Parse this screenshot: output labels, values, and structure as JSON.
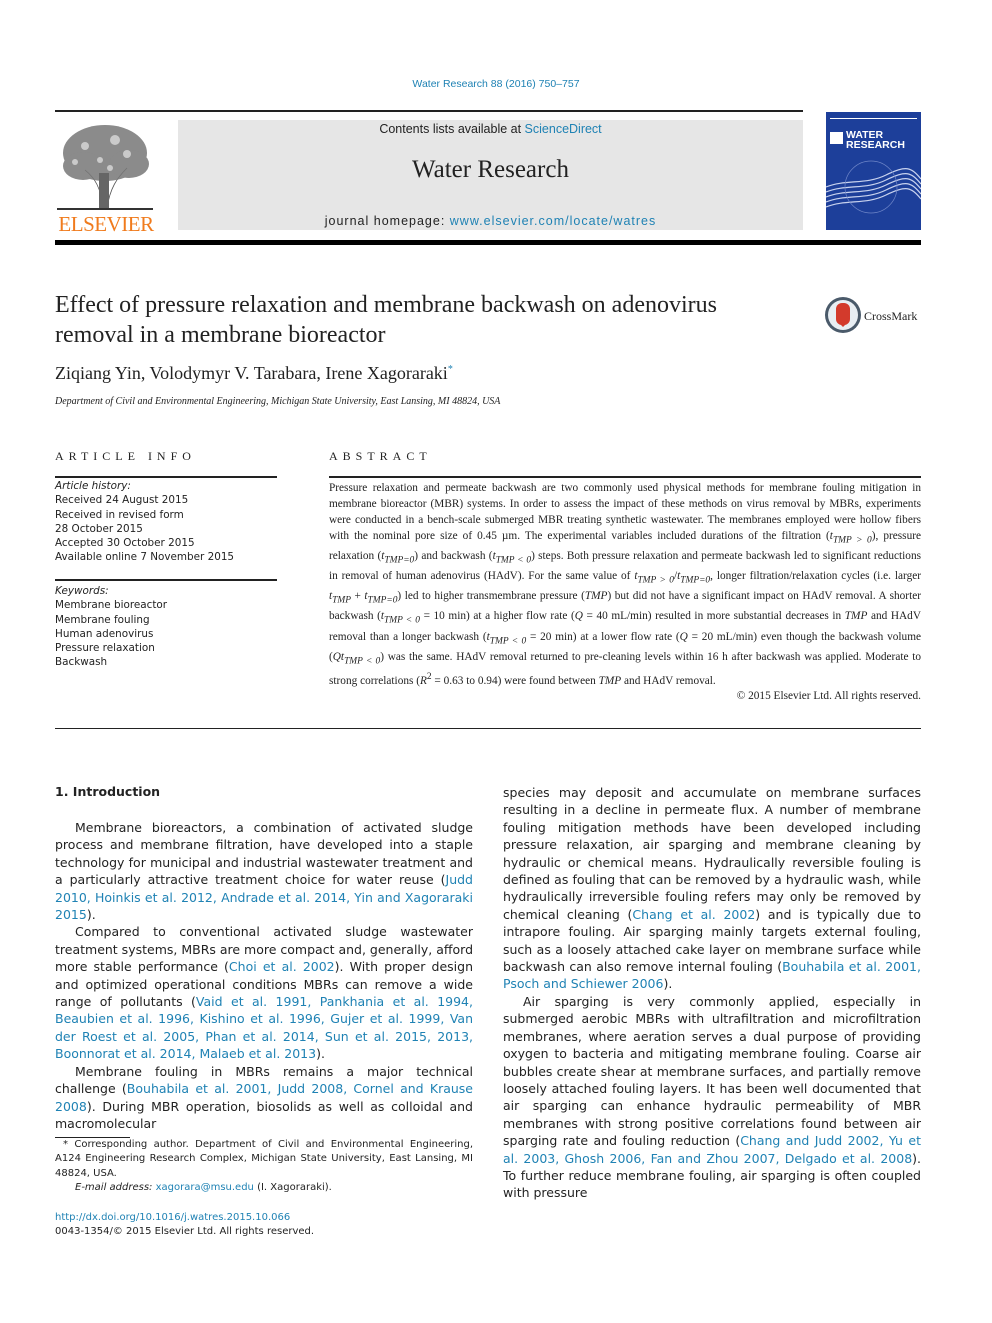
{
  "header": {
    "citation": "Water Research 88 (2016) 750–757",
    "contents_prefix": "Contents lists available at ",
    "contents_link": "ScienceDirect",
    "journal_title": "Water Research",
    "homepage_prefix": "journal homepage: ",
    "homepage_link": "www.elsevier.com/locate/watres",
    "publisher_logo_text": "ELSEVIER",
    "cover_title_line1": "WATER",
    "cover_title_line2": "RESEARCH",
    "brand_orange": "#f07b1d",
    "link_color": "#1f82b4",
    "cover_color": "#1d3f9a"
  },
  "article": {
    "title_line1": "Effect of pressure relaxation and membrane backwash on adenovirus",
    "title_line2": "removal in a membrane bioreactor",
    "crossmark_label": "CrossMark",
    "authors": "Ziqiang Yin, Volodymyr V. Tarabara, Irene Xagoraraki",
    "corresponding_mark": "*",
    "affiliation": "Department of Civil and Environmental Engineering, Michigan State University, East Lansing, MI 48824, USA"
  },
  "article_info": {
    "heading": "ARTICLE INFO",
    "history_label": "Article history:",
    "history": [
      "Received 24 August 2015",
      "Received in revised form",
      "28 October 2015",
      "Accepted 30 October 2015",
      "Available online 7 November 2015"
    ],
    "keywords_label": "Keywords:",
    "keywords": [
      "Membrane bioreactor",
      "Membrane fouling",
      "Human adenovirus",
      "Pressure relaxation",
      "Backwash"
    ]
  },
  "abstract": {
    "heading": "ABSTRACT",
    "s1": "Pressure relaxation and permeate backwash are two commonly used physical methods for membrane fouling mitigation in membrane bioreactor (MBR) systems. In order to assess the impact of these methods on virus removal by MBRs, experiments were conducted in a bench-scale submerged MBR treating synthetic wastewater. The membranes employed were hollow fibers with the nominal pore size of 0.45 µm. The experimental variables included durations of the filtration (",
    "v_tgt": "t",
    "sub_gt": "TMP > 0",
    "s2": "), pressure relaxation (",
    "sub_eq": "TMP=0",
    "s3": ") and backwash (",
    "sub_lt": "TMP < 0",
    "s4": ") steps. Both pressure relaxation and permeate backwash led to significant reductions in removal of human adenovirus (HAdV). For the same value of ",
    "s5": "/",
    "s6": ", longer filtration/relaxation cycles (i.e. larger ",
    "sub_tmp": "TMP",
    "s7": " + ",
    "s8": ") led to higher transmembrane pressure (",
    "tmp_italic": "TMP",
    "s9": ") but did not have a significant impact on HAdV removal. A shorter backwash (",
    "s10": " = 10 min) at a higher flow rate (",
    "q": "Q",
    "s11": " = 40 mL/min) resulted in more substantial decreases in ",
    "s12": " and HAdV removal than a longer backwash (",
    "s13": " = 20 min) at a lower flow rate (",
    "s14": " = 20 mL/min) even though the backwash volume (",
    "qt": "Qt",
    "s15": ") was the same. HAdV removal returned to pre-cleaning levels within 16 h after backwash was applied. Moderate to strong correlations (",
    "r": "R",
    "r_sup": "2",
    "s16": " = 0.63 to 0.94) were found between ",
    "s17": " and HAdV removal.",
    "copyright": "© 2015 Elsevier Ltd. All rights reserved."
  },
  "body": {
    "intro_heading": "1.  Introduction",
    "p1_text": "Membrane bioreactors, a combination of activated sludge process and membrane filtration, have developed into a staple technology for municipal and industrial wastewater treatment and a particularly attractive treatment choice for water reuse (",
    "p1_refs": "Judd 2010, Hoinkis et al. 2012, Andrade et al. 2014, Yin and Xagoraraki 2015",
    "p1_end": ").",
    "p2_text": "Compared to conventional activated sludge wastewater treatment systems, MBRs are more compact and, generally, afford more stable performance (",
    "p2_ref1": "Choi et al. 2002",
    "p2_mid": "). With proper design and optimized operational conditions MBRs can remove a wide range of pollutants (",
    "p2_refs2": "Vaid et al. 1991, Pankhania et al. 1994, Beaubien et al. 1996, Kishino et al. 1996, Gujer et al. 1999, Van der Roest et al. 2005, Phan et al. 2014, Sun et al. 2015, 2013, Boonnorat et al. 2014, Malaeb et al. 2013",
    "p2_end": ").",
    "p3_text": "Membrane fouling in MBRs remains a major technical challenge (",
    "p3_refs": "Bouhabila et al. 2001, Judd 2008, Cornel and Krause 2008",
    "p3_end": "). During MBR operation, biosolids as well as colloidal and macromolecular",
    "r1_text": "species may deposit and accumulate on membrane surfaces resulting in a decline in permeate flux. A number of membrane fouling mitigation methods have been developed including pressure relaxation, air sparging and membrane cleaning by hydraulic or chemical means. Hydraulically reversible fouling is defined as fouling that can be removed by a hydraulic wash, while hydraulically irreversible fouling refers may only be removed by chemical cleaning (",
    "r1_ref1": "Chang et al. 2002",
    "r1_mid": ") and is typically due to intrapore fouling. Air sparging mainly targets external fouling, such as a loosely attached cake layer on membrane surface while backwash can also remove internal fouling (",
    "r1_refs2": "Bouhabila et al. 2001, Psoch and Schiewer 2006",
    "r1_end": ").",
    "r2_text": "Air sparging is very commonly applied, especially in submerged aerobic MBRs with ultrafiltration and microfiltration membranes, where aeration serves a dual purpose of providing oxygen to bacteria and mitigating membrane fouling. Coarse air bubbles create shear at membrane surfaces, and partially remove loosely attached fouling layers. It has been well documented that air sparging can enhance hydraulic permeability of MBR membranes with strong positive correlations found between air sparging rate and fouling reduction (",
    "r2_refs": "Chang and Judd 2002, Yu et al. 2003, Ghosh 2006, Fan and Zhou 2007, Delgado et al. 2008",
    "r2_end": "). To further reduce membrane fouling, air sparging is often coupled with pressure"
  },
  "footnote": {
    "corresponding": "* Corresponding author. Department of Civil and Environmental Engineering, A124 Engineering Research Complex, Michigan State University, East Lansing, MI 48824, USA.",
    "email_label": "E-mail address: ",
    "email": "xagorara@msu.edu",
    "email_suffix": " (I. Xagoraraki).",
    "doi": "http://dx.doi.org/10.1016/j.watres.2015.10.066",
    "issn": "0043-1354/© 2015 Elsevier Ltd. All rights reserved."
  }
}
